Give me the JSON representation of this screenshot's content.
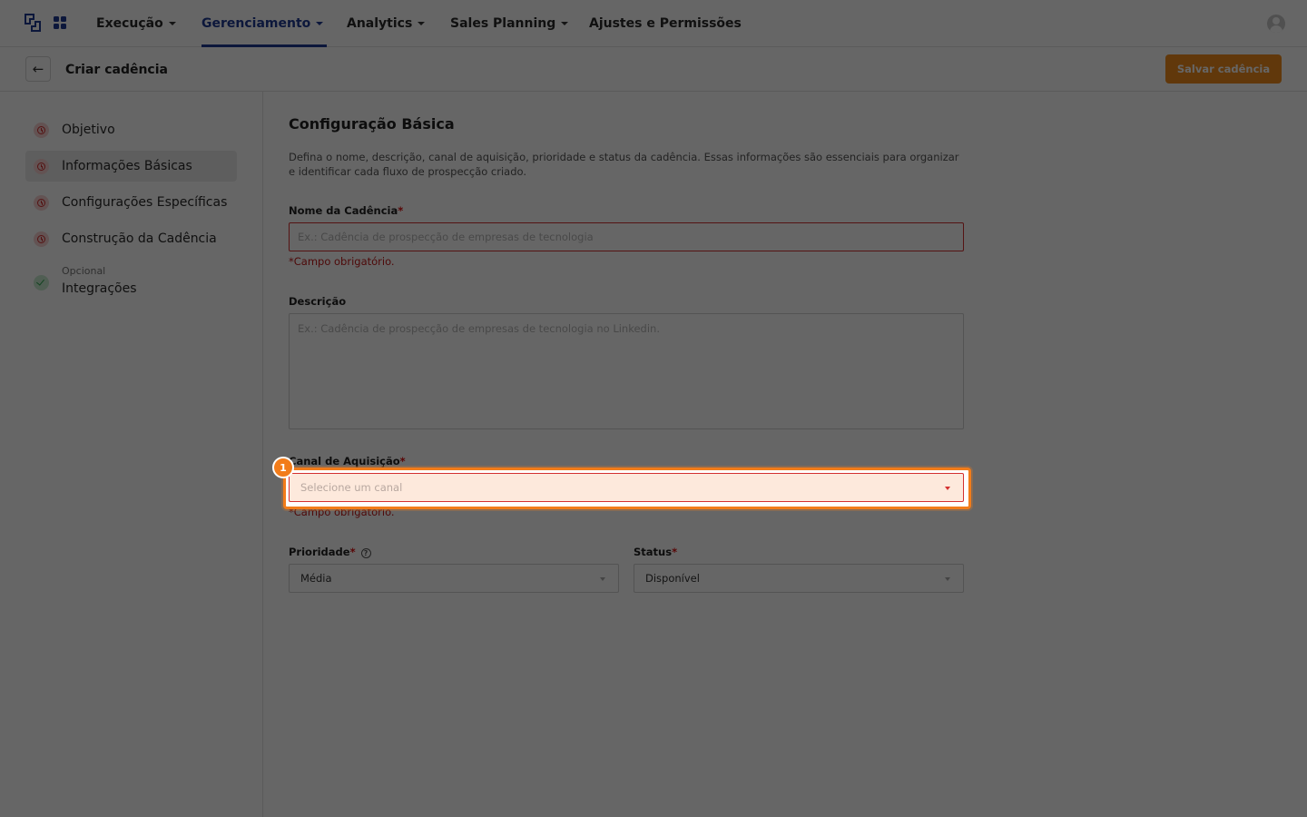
{
  "topnav": {
    "items": [
      {
        "label": "Execução",
        "has_caret": true,
        "active": false
      },
      {
        "label": "Gerenciamento",
        "has_caret": true,
        "active": true
      },
      {
        "label": "Analytics",
        "has_caret": true,
        "active": false
      },
      {
        "label": "Sales Planning",
        "has_caret": true,
        "active": false
      },
      {
        "label": "Ajustes e Permissões",
        "has_caret": false,
        "active": false
      }
    ],
    "icons": [
      "logo-icon",
      "apps-grid-icon",
      "user-avatar-icon"
    ]
  },
  "header": {
    "back_icon": "arrow-left-icon",
    "title": "Criar cadência",
    "save_label": "Salvar cadência"
  },
  "sidebar": {
    "steps": [
      {
        "label": "Objetivo",
        "status": "error"
      },
      {
        "label": "Informações Básicas",
        "status": "error",
        "active": true
      },
      {
        "label": "Configurações Específicas",
        "status": "error"
      },
      {
        "label": "Construção da Cadência",
        "status": "error"
      },
      {
        "sublabel": "Opcional",
        "label": "Integrações",
        "status": "ok"
      }
    ]
  },
  "form": {
    "title": "Configuração Básica",
    "description": "Defina o nome, descrição, canal de aquisição, prioridade e status da cadência. Essas informações são essenciais para organizar e identificar cada fluxo de prospecção criado.",
    "required_mark": "*",
    "name": {
      "label": "Nome da Cadência",
      "placeholder": "Ex.: Cadência de prospecção de empresas de tecnologia",
      "error": "*Campo obrigatório."
    },
    "description_field": {
      "label": "Descrição",
      "placeholder": "Ex.: Cadência de prospecção de empresas de tecnologia no Linkedin."
    },
    "channel": {
      "label": "Canal de Aquisição",
      "placeholder": "Selecione um canal",
      "error": "*Campo obrigatório."
    },
    "priority": {
      "label": "Prioridade",
      "help_glyph": "?",
      "value": "Média"
    },
    "status": {
      "label": "Status",
      "value": "Disponível"
    }
  },
  "highlight": {
    "badge": "1",
    "color": "#f27c1a"
  },
  "colors": {
    "brand": "#1f3a93",
    "accent": "#f28c1c",
    "error": "#c21818"
  }
}
